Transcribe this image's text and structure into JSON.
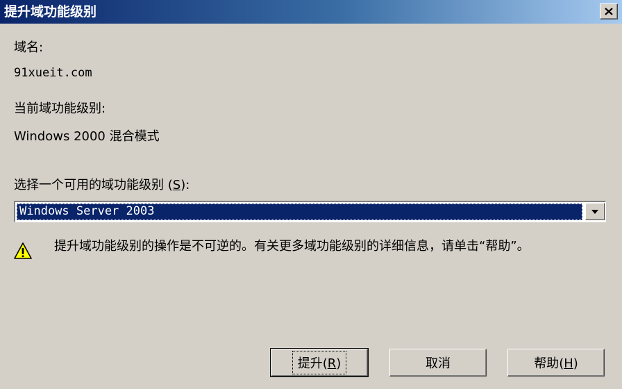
{
  "window": {
    "title": "提升域功能级别",
    "close_label": "×"
  },
  "domain_name": {
    "label": "域名:",
    "value": "91xueit.com"
  },
  "current_level": {
    "label": "当前域功能级别:",
    "value": "Windows 2000 混合模式"
  },
  "select_level": {
    "label": "选择一个可用的域功能级别",
    "accelerator": "S",
    "label_suffix": ":",
    "selected": "Windows Server 2003"
  },
  "warning": {
    "icon": "warning-icon",
    "text": "提升域功能级别的操作是不可逆的。有关更多域功能级别的详细信息，请单击“帮助”。"
  },
  "buttons": {
    "raise": {
      "label": "提升",
      "accelerator": "R"
    },
    "cancel": {
      "label": "取消"
    },
    "help": {
      "label": "帮助",
      "accelerator": "H"
    }
  },
  "colors": {
    "dialog_bg": "#d4d0c8",
    "titlebar_start": "#0a246a",
    "titlebar_end": "#a6caf0",
    "selection": "#0a246a",
    "warning_yellow": "#ffff00"
  }
}
